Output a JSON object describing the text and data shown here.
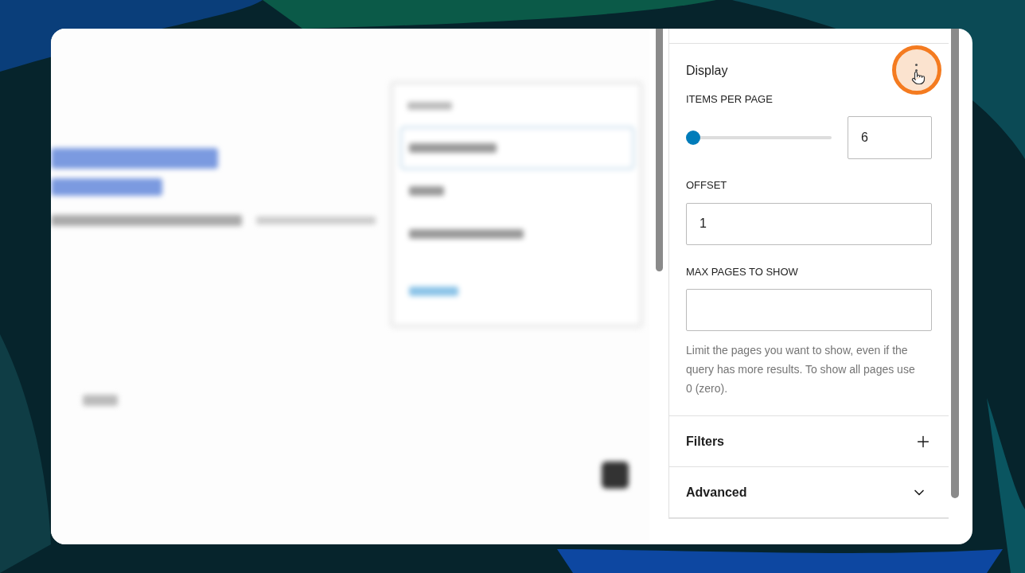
{
  "panel": {
    "title": "Display",
    "items_per_page": {
      "label": "ITEMS PER PAGE",
      "level": 0.0,
      "value": "6"
    },
    "offset": {
      "label": "OFFSET",
      "value": "1"
    },
    "max_pages": {
      "label": "MAX PAGES TO SHOW",
      "help": "Limit the pages you want to show, even if the query has more results. To show all pages use 0 (zero)."
    },
    "sections": [
      {
        "title": "Filters",
        "kind": "plus"
      },
      {
        "title": "Advanced",
        "kind": "chevron"
      }
    ]
  }
}
